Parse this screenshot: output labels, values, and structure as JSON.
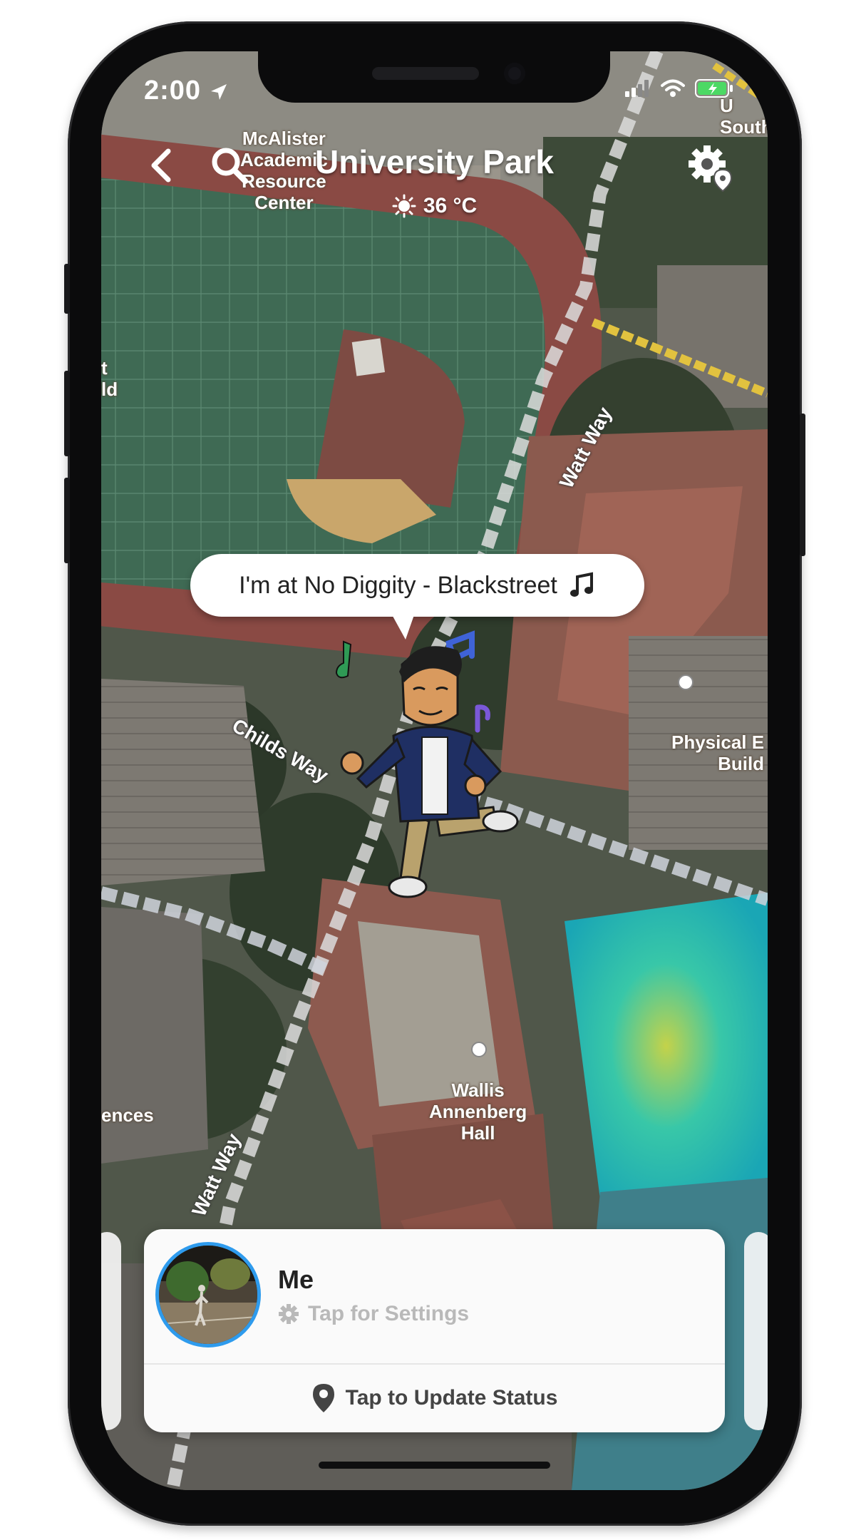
{
  "status_bar": {
    "time": "2:00"
  },
  "header": {
    "title": "University Park",
    "temperature": "36 °C"
  },
  "map_labels": {
    "mcalister": "McAlister\nAcademic\nResource\nCenter",
    "physical_ed": "Physical E\nBuild",
    "wallis": "Wallis\nAnnenberg\nHall",
    "ences": "ences",
    "left_edge": "t\nld",
    "top_right": "U\nSouth",
    "watt_way_top": "Watt Way",
    "watt_way_bottom": "Watt Way",
    "childs_way": "Childs Way"
  },
  "bubble": {
    "text": "I'm at No Diggity - Blackstreet",
    "icon": "music-note-icon"
  },
  "card": {
    "name": "Me",
    "settings_hint": "Tap for Settings",
    "status_action": "Tap to Update Status"
  },
  "colors": {
    "avatar_ring": "#2e9bed",
    "card_bg": "#fafafa",
    "hint_gray": "#b9b9b9"
  }
}
